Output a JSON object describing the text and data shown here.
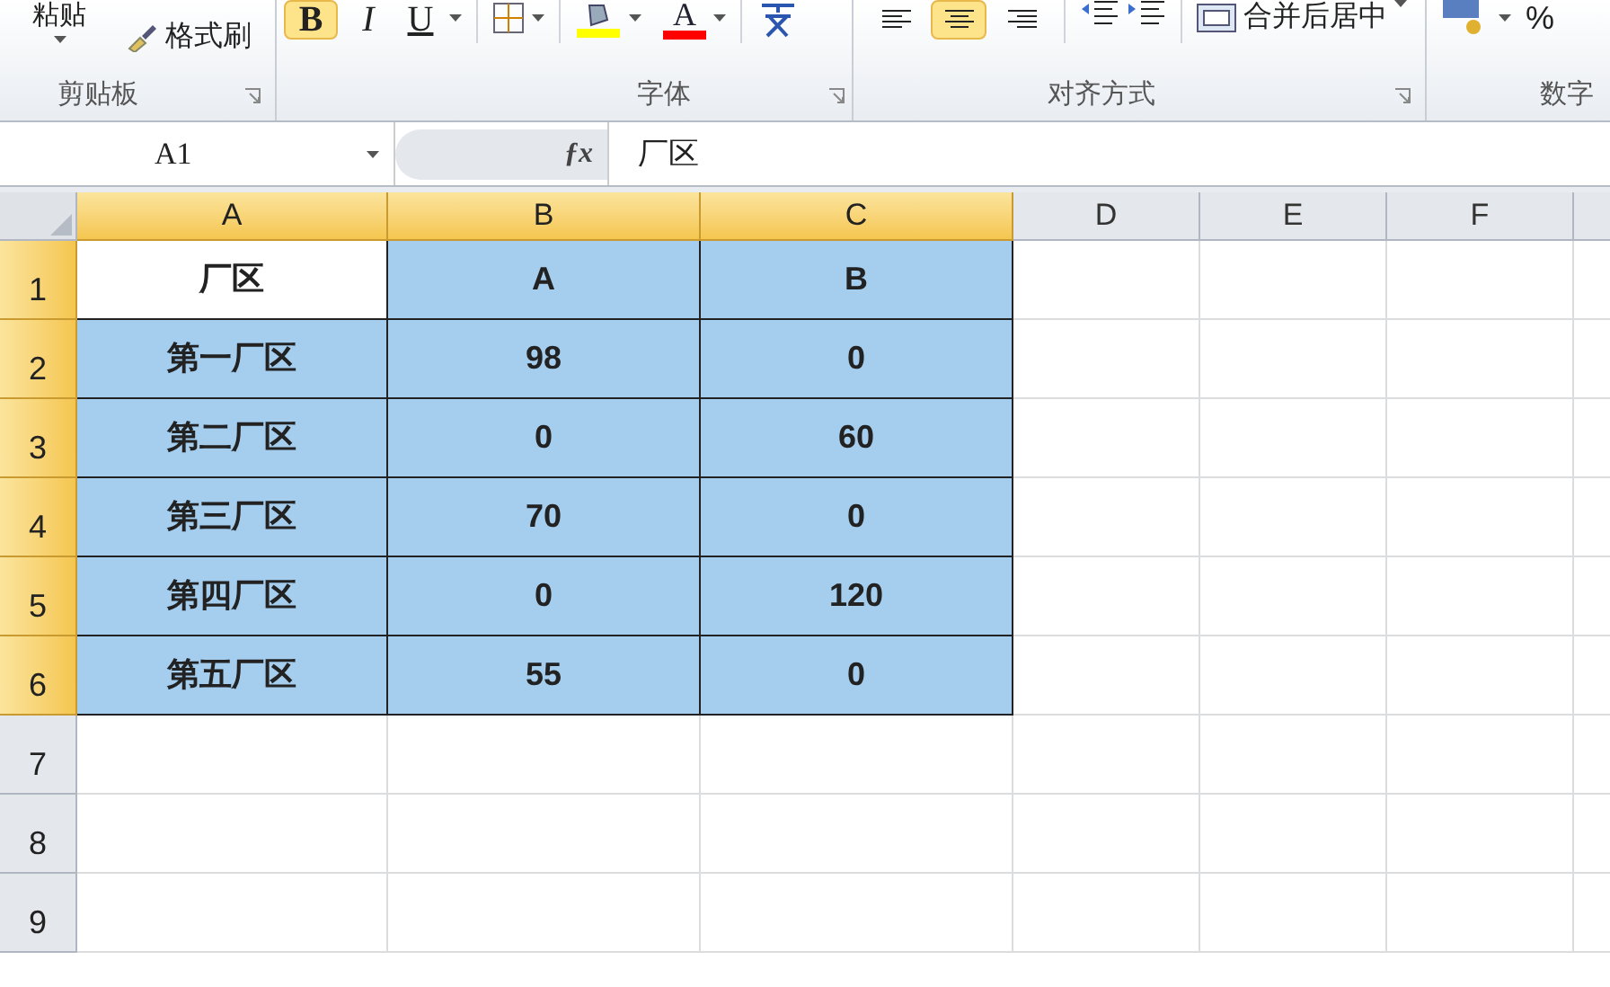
{
  "ribbon": {
    "clipboard": {
      "paste": "粘贴",
      "format_painter": "格式刷",
      "label": "剪贴板"
    },
    "font": {
      "bold": {
        "label": "B",
        "selected": true
      },
      "italic": {
        "label": "I",
        "selected": false
      },
      "underline": {
        "label": "U",
        "selected": false
      },
      "font_color": "A",
      "label": "字体"
    },
    "alignment": {
      "align_buttons": [
        {
          "kind": "left",
          "selected": false
        },
        {
          "kind": "center",
          "selected": true
        },
        {
          "kind": "right",
          "selected": false
        }
      ],
      "merge": "合并后居中",
      "label": "对齐方式"
    },
    "number": {
      "percent": "%",
      "label": "数字"
    }
  },
  "formula_bar": {
    "name_box": "A1",
    "function_button": "ƒx",
    "formula": "厂区"
  },
  "columns": [
    {
      "label": "A",
      "selected": true
    },
    {
      "label": "B",
      "selected": true
    },
    {
      "label": "C",
      "selected": true
    },
    {
      "label": "D",
      "selected": false
    },
    {
      "label": "E",
      "selected": false
    },
    {
      "label": "F",
      "selected": false
    }
  ],
  "rows": [
    {
      "label": "1",
      "selected": true,
      "cells": [
        {
          "text": "厂区",
          "selected": false
        },
        {
          "text": "A",
          "selected": true
        },
        {
          "text": "B",
          "selected": true
        }
      ]
    },
    {
      "label": "2",
      "selected": true,
      "cells": [
        {
          "text": "第一厂区",
          "selected": true
        },
        {
          "text": "98",
          "selected": true
        },
        {
          "text": "0",
          "selected": true
        }
      ]
    },
    {
      "label": "3",
      "selected": true,
      "cells": [
        {
          "text": "第二厂区",
          "selected": true
        },
        {
          "text": "0",
          "selected": true
        },
        {
          "text": "60",
          "selected": true
        }
      ]
    },
    {
      "label": "4",
      "selected": true,
      "cells": [
        {
          "text": "第三厂区",
          "selected": true
        },
        {
          "text": "70",
          "selected": true
        },
        {
          "text": "0",
          "selected": true
        }
      ]
    },
    {
      "label": "5",
      "selected": true,
      "cells": [
        {
          "text": "第四厂区",
          "selected": true
        },
        {
          "text": "0",
          "selected": true
        },
        {
          "text": "120",
          "selected": true
        }
      ]
    },
    {
      "label": "6",
      "selected": true,
      "cells": [
        {
          "text": "第五厂区",
          "selected": true
        },
        {
          "text": "55",
          "selected": true
        },
        {
          "text": "0",
          "selected": true
        }
      ]
    },
    {
      "label": "7",
      "selected": false,
      "cells": []
    },
    {
      "label": "8",
      "selected": false,
      "cells": []
    },
    {
      "label": "9",
      "selected": false,
      "cells": []
    }
  ]
}
